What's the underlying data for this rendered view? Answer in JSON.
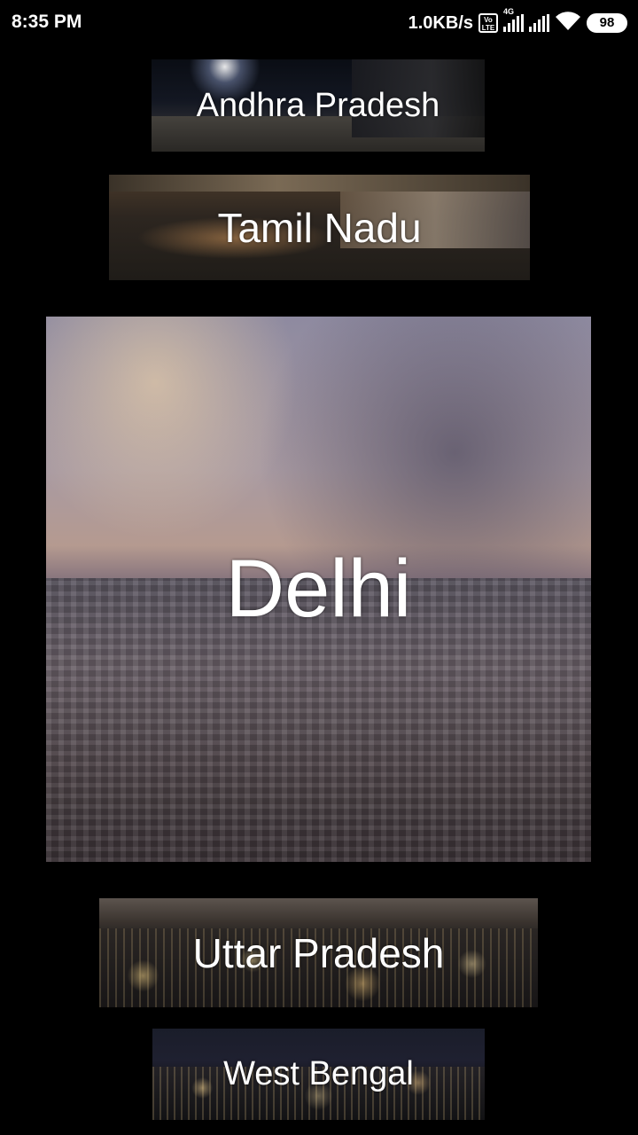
{
  "status_bar": {
    "time": "8:35 PM",
    "net_speed": "1.0KB/s",
    "volte_label": "Vo LTE",
    "network_type": "4G",
    "battery": "98"
  },
  "states": [
    {
      "name": "Andhra Pradesh"
    },
    {
      "name": "Tamil Nadu"
    },
    {
      "name": "Delhi"
    },
    {
      "name": "Uttar Pradesh"
    },
    {
      "name": "West Bengal"
    }
  ]
}
